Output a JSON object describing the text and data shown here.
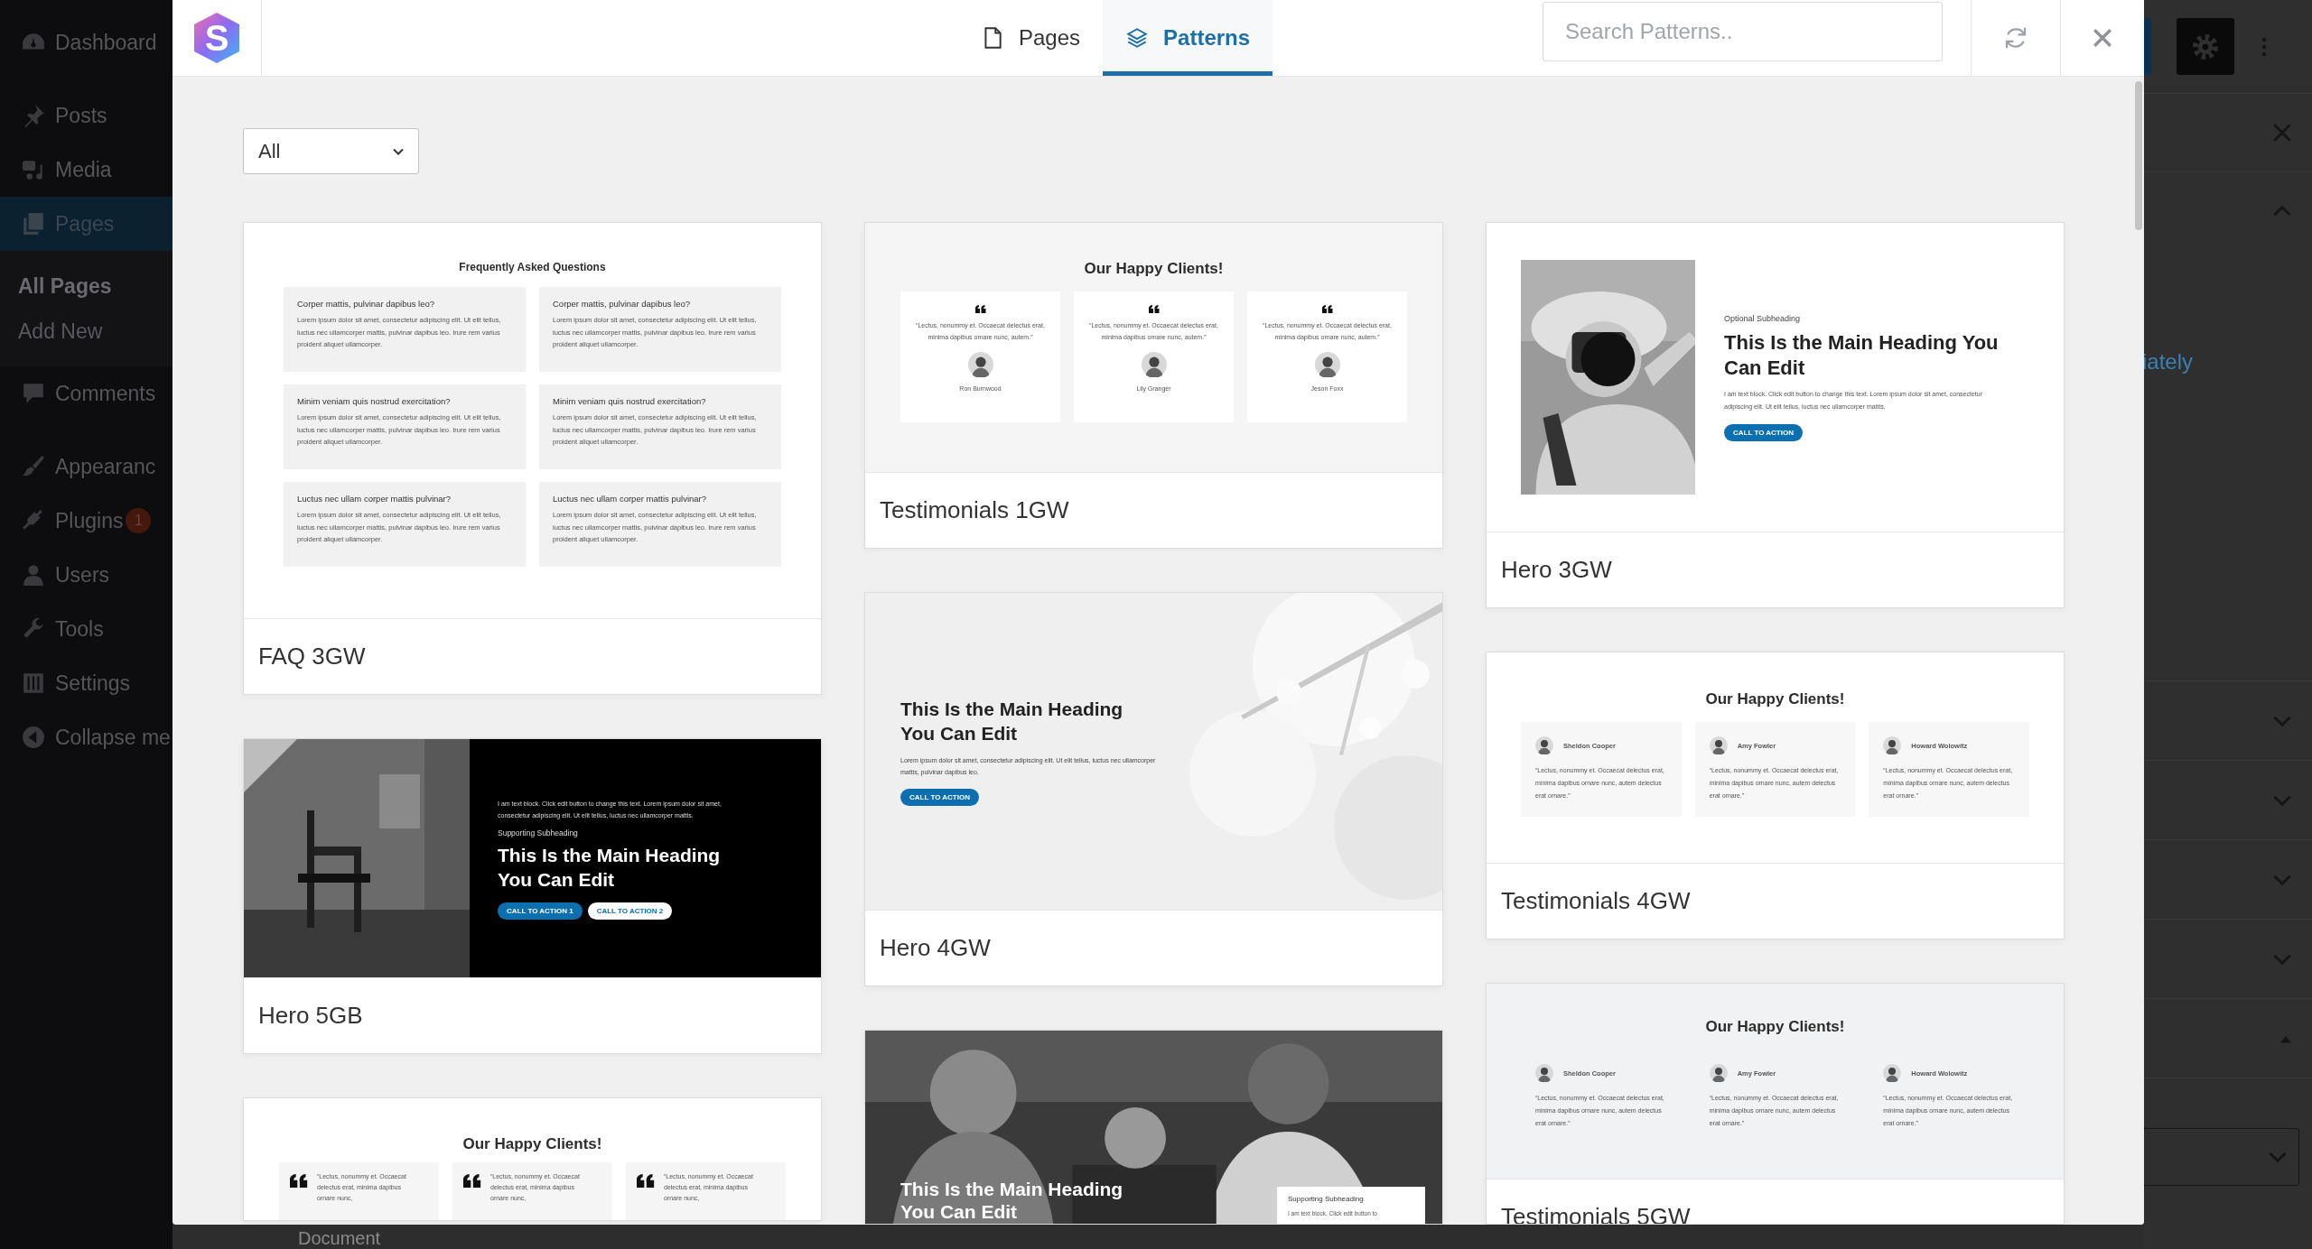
{
  "sidebar": {
    "items": [
      {
        "label": "Dashboard",
        "selected": false
      },
      {
        "label": "Posts",
        "selected": false
      },
      {
        "label": "Media",
        "selected": false
      },
      {
        "label": "Pages",
        "selected": true,
        "children": [
          {
            "label": "All Pages",
            "selected": true
          },
          {
            "label": "Add New",
            "selected": false
          }
        ]
      },
      {
        "label": "Comments",
        "selected": false
      },
      {
        "label": "Appearanc",
        "selected": false
      },
      {
        "label": "Plugins",
        "selected": false,
        "badge": "1"
      },
      {
        "label": "Users",
        "selected": false
      },
      {
        "label": "Tools",
        "selected": false
      },
      {
        "label": "Settings",
        "selected": false
      },
      {
        "label": "Collapse me",
        "selected": false
      }
    ]
  },
  "editor": {
    "footer_label": "Document"
  },
  "settings_panel": {
    "text": "iately"
  },
  "modal": {
    "logo": "S",
    "tabs": [
      {
        "label": "Pages",
        "selected": false
      },
      {
        "label": "Patterns",
        "selected": true
      }
    ],
    "search": {
      "placeholder": "Search Patterns.."
    },
    "filter": {
      "value": "All"
    },
    "columns": [
      [
        {
          "title": "FAQ 3GW",
          "preview": {
            "kind": "faq",
            "heading": "Frequently Asked Questions",
            "items": [
              {
                "question": "Corper mattis, pulvinar dapibus leo?",
                "answer": "Lorem ipsum dolor sit amet, consectetur adipiscing elit. Ut elit tellus, luctus nec ullamcorper mattis, pulvinar dapibus leo. Irure rem varius proident aliquet ullamcorper."
              },
              {
                "question": "Corper mattis, pulvinar dapibus leo?",
                "answer": "Lorem ipsum dolor sit amet, consectetur adipiscing elit. Ut elit tellus, luctus nec ullamcorper mattis, pulvinar dapibus leo. Irure rem varius proident aliquet ullamcorper."
              },
              {
                "question": "Minim veniam quis nostrud exercitation?",
                "answer": "Lorem ipsum dolor sit amet, consectetur adipiscing elit. Ut elit tellus, luctus nec ullamcorper mattis, pulvinar dapibus leo. Irure rem varius proident aliquet ullamcorper."
              },
              {
                "question": "Minim veniam quis nostrud exercitation?",
                "answer": "Lorem ipsum dolor sit amet, consectetur adipiscing elit. Ut elit tellus, luctus nec ullamcorper mattis, pulvinar dapibus leo. Irure rem varius proident aliquet ullamcorper."
              },
              {
                "question": "Luctus nec ullam corper mattis pulvinar?",
                "answer": "Lorem ipsum dolor sit amet, consectetur adipiscing elit. Ut elit tellus, luctus nec ullamcorper mattis, pulvinar dapibus leo. Irure rem varius proident aliquet ullamcorper."
              },
              {
                "question": "Luctus nec ullam corper mattis pulvinar?",
                "answer": "Lorem ipsum dolor sit amet, consectetur adipiscing elit. Ut elit tellus, luctus nec ullamcorper mattis, pulvinar dapibus leo. Irure rem varius proident aliquet ullamcorper."
              }
            ]
          }
        },
        {
          "title": "Hero 5GB",
          "preview": {
            "kind": "hero-dark",
            "text": "I am text block. Click edit button to change this text. Lorem ipsum dolor sit amet, consectetur adipiscing elit. Ut elit tellus, luctus nec ullamcorper mattis.",
            "subheading": "Supporting Subheading",
            "heading": "This Is the Main Heading You Can Edit",
            "buttons": [
              "CALL TO ACTION 1",
              "CALL TO ACTION 2"
            ]
          }
        },
        {
          "preview": {
            "kind": "quotes-side",
            "heading": "Our Happy Clients!",
            "items": [
              {
                "quote": "“Lectus, nonummy et. Occaecat delectus erat, minima dapibus ornare nunc,"
              },
              {
                "quote": "“Lectus, nonummy et. Occaecat delectus erat, minima dapibus ornare nunc,"
              },
              {
                "quote": "“Lectus, nonummy et. Occaecat delectus erat, minima dapibus ornare nunc,"
              }
            ]
          }
        }
      ],
      [
        {
          "title": "Testimonials 1GW",
          "preview": {
            "kind": "quotes",
            "heading": "Our Happy Clients!",
            "items": [
              {
                "quote": "“Lectus, nonummy et. Occaecat delectus erat, minima dapibus ornare nunc, autem.”",
                "name": "Ron Burnwood"
              },
              {
                "quote": "“Lectus, nonummy et. Occaecat delectus erat, minima dapibus ornare nunc, autem.”",
                "name": "Lily Granger"
              },
              {
                "quote": "“Lectus, nonummy et. Occaecat delectus erat, minima dapibus ornare nunc, autem.”",
                "name": "Jeson Foxx"
              }
            ]
          }
        },
        {
          "title": "Hero 4GW",
          "preview": {
            "kind": "hero-bg",
            "heading": "This Is the Main Heading You Can Edit",
            "text": "Lorem ipsum dolor sit amet, consectetur adipiscing elit. Ut elit tellus, luctus nec ullamcorper mattis, pulvinar dapibus leo.",
            "button": "CALL TO ACTION"
          }
        },
        {
          "preview": {
            "kind": "hero-photo",
            "heading": "This Is the Main Heading You Can Edit",
            "subheading": "Supporting Subheading",
            "text": "I am text block. Click edit button to"
          }
        }
      ],
      [
        {
          "title": "Hero 3GW",
          "preview": {
            "kind": "hero-split",
            "subheading": "Optional Subheading",
            "heading": "This Is the Main Heading You Can Edit",
            "text": "I am text block. Click edit button to change this text. Lorem ipsum dolor sit amet, consectetur adipiscing elit. Ut elit tellus, luctus nec ullamcorper mattis.",
            "button": "CALL TO ACTION"
          }
        },
        {
          "title": "Testimonials 4GW",
          "preview": {
            "kind": "people-cards",
            "heading": "Our Happy Clients!",
            "items": [
              {
                "name": "Sheldon Cooper",
                "quote": "“Lectus, nonummy et. Occaecat delectus erat, minima dapibus ornare nunc, autem delectus erat ornare.”"
              },
              {
                "name": "Amy Fowler",
                "quote": "“Lectus, nonummy et. Occaecat delectus erat, minima dapibus ornare nunc, autem delectus erat ornare.”"
              },
              {
                "name": "Howard Wolowitz",
                "quote": "“Lectus, nonummy et. Occaecat delectus erat, minima dapibus ornare nunc, autem delectus erat ornare.”"
              }
            ]
          }
        },
        {
          "title": "Testimonials 5GW",
          "preview": {
            "kind": "people-plain",
            "heading": "Our Happy Clients!",
            "items": [
              {
                "name": "Sheldon Cooper",
                "quote": "“Lectus, nonummy et. Occaecat delectus erat, minima dapibus ornare nunc, autem delectus erat ornare.”"
              },
              {
                "name": "Amy Fowler",
                "quote": "“Lectus, nonummy et. Occaecat delectus erat, minima dapibus ornare nunc, autem delectus erat ornare.”"
              },
              {
                "name": "Howard Wolowitz",
                "quote": "“Lectus, nonummy et. Occaecat delectus erat, minima dapibus ornare nunc, autem delectus erat ornare.”"
              }
            ]
          }
        }
      ]
    ]
  }
}
